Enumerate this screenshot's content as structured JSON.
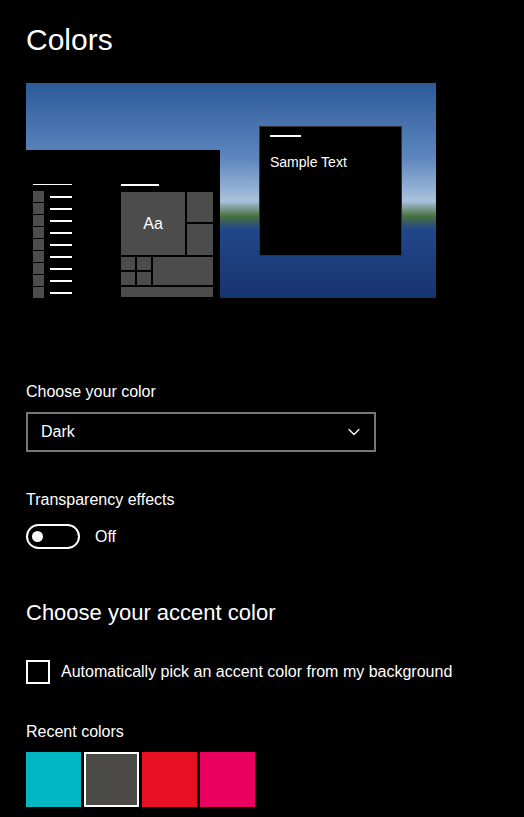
{
  "page": {
    "title": "Colors"
  },
  "preview": {
    "tile_text": "Aa",
    "window_text": "Sample Text"
  },
  "color_mode": {
    "label": "Choose your color",
    "value": "Dark"
  },
  "transparency": {
    "label": "Transparency effects",
    "on": false,
    "state_text": "Off"
  },
  "accent": {
    "heading": "Choose your accent color",
    "auto_pick": {
      "label": "Automatically pick an accent color from my background",
      "checked": false
    }
  },
  "recent_colors": {
    "label": "Recent colors",
    "items": [
      {
        "color": "#00b7c3",
        "selected": false
      },
      {
        "color": "#4c4a48",
        "selected": true
      },
      {
        "color": "#e81123",
        "selected": false
      },
      {
        "color": "#ea005e",
        "selected": false
      }
    ]
  }
}
